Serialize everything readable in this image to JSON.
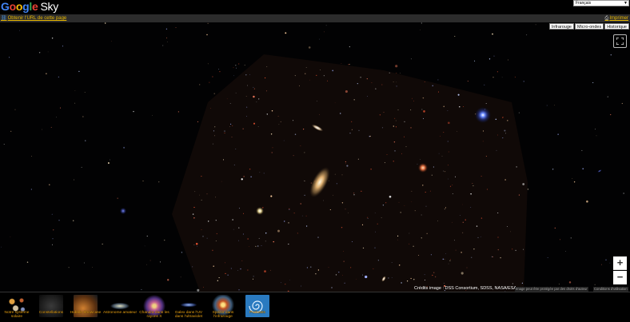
{
  "header": {
    "logo_google": "Google",
    "logo_sky": "Sky",
    "language_selected": "Français"
  },
  "linkbar": {
    "url_link": "Obtenir l'URL de cette page",
    "print_link": "Imprimer"
  },
  "layers": [
    {
      "label": "Infrarouge"
    },
    {
      "label": "Micro-ondes"
    },
    {
      "label": "Historique"
    }
  ],
  "controls": {
    "zoom_in": "+",
    "zoom_out": "−",
    "fullscreen_icon": "fullscreen-icon"
  },
  "footer": {
    "credits": "Crédits image : DSS Consortium, SDSS, NASA/ESA",
    "copyright": "Image peut être protégée par des droits d'auteur",
    "terms": "Conditions d'utilisation"
  },
  "gallery": [
    {
      "label": "Notre système solaire"
    },
    {
      "label": "Constellations"
    },
    {
      "label": "Hubble Showcase"
    },
    {
      "label": "Astronome amateur"
    },
    {
      "label": "Chandra dans les rayons X"
    },
    {
      "label": "Galex dans l'UV dans l'ultraviolet"
    },
    {
      "label": "Spitzer dans l'infrarouge"
    },
    {
      "label": "Podcasts"
    }
  ]
}
